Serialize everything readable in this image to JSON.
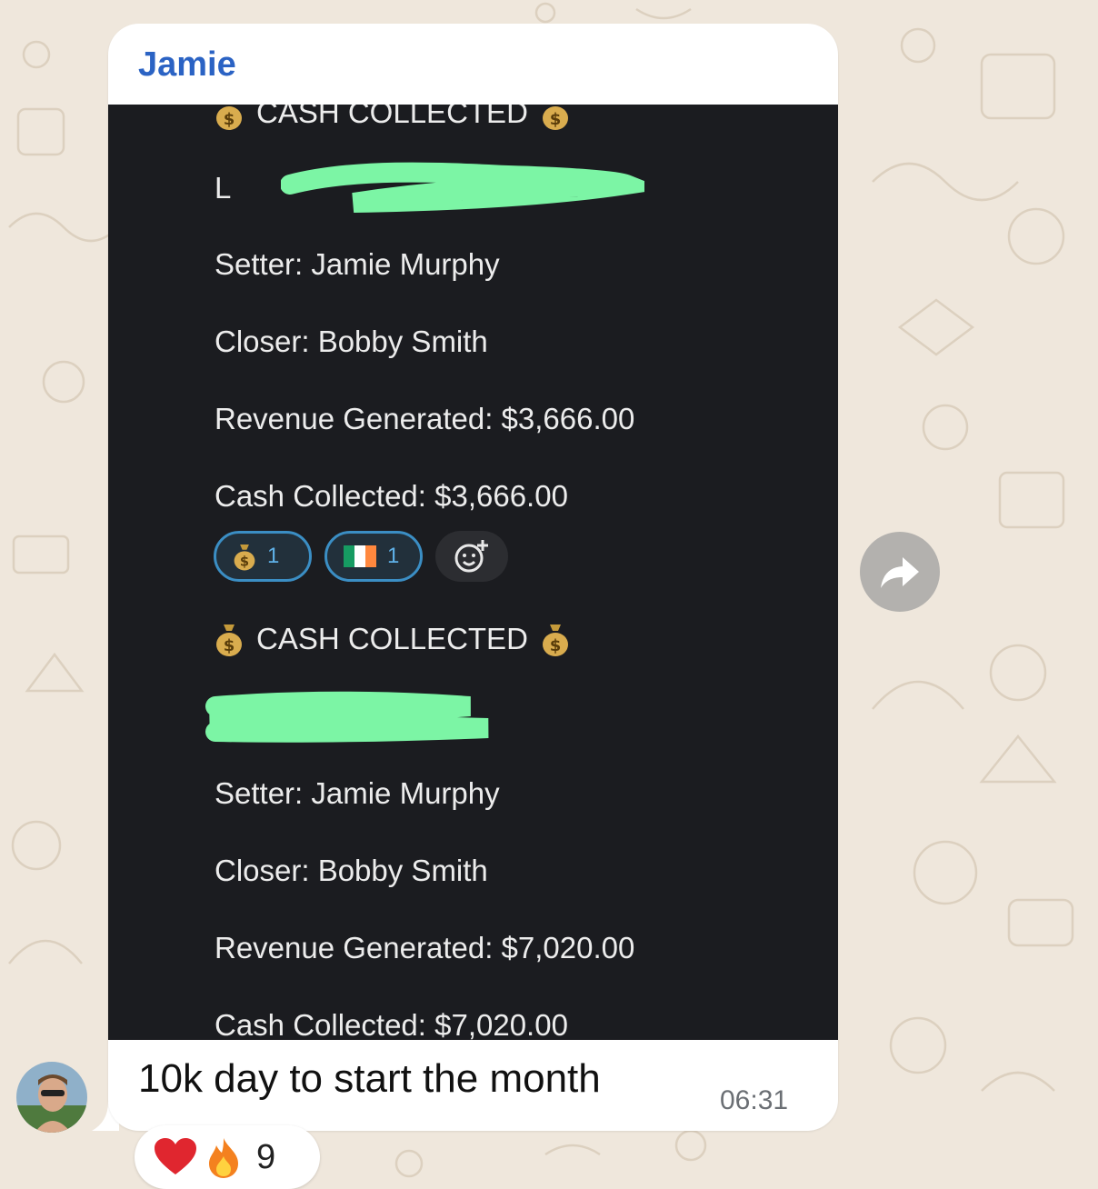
{
  "message": {
    "sender": "Jamie",
    "caption": "10k day to start the month",
    "time": "06:31"
  },
  "screenshot": {
    "heading_partial": "CASH COLLECTED",
    "blurred_line_partial": "L",
    "entry1": {
      "setter": "Setter: Jamie Murphy",
      "closer": "Closer: Bobby Smith",
      "revenue": "Revenue Generated: $3,666.00",
      "cash": "Cash Collected: $3,666.00"
    },
    "reactions": [
      {
        "emoji": "money-bag",
        "count": "1"
      },
      {
        "emoji": "ireland-flag",
        "count": "1"
      }
    ],
    "heading": "CASH COLLECTED",
    "entry2": {
      "setter": "Setter: Jamie Murphy",
      "closer": "Closer: Bobby Smith",
      "revenue": "Revenue Generated: $7,020.00",
      "cash": "Cash Collected: $7,020.00"
    }
  },
  "message_reactions": {
    "emojis": [
      "heart",
      "fire"
    ],
    "count": "9"
  },
  "colors": {
    "sender_name": "#2b63c4",
    "redaction": "#7cf5a5",
    "screenshot_bg": "#1b1c20",
    "chat_bg": "#efe7dc"
  }
}
